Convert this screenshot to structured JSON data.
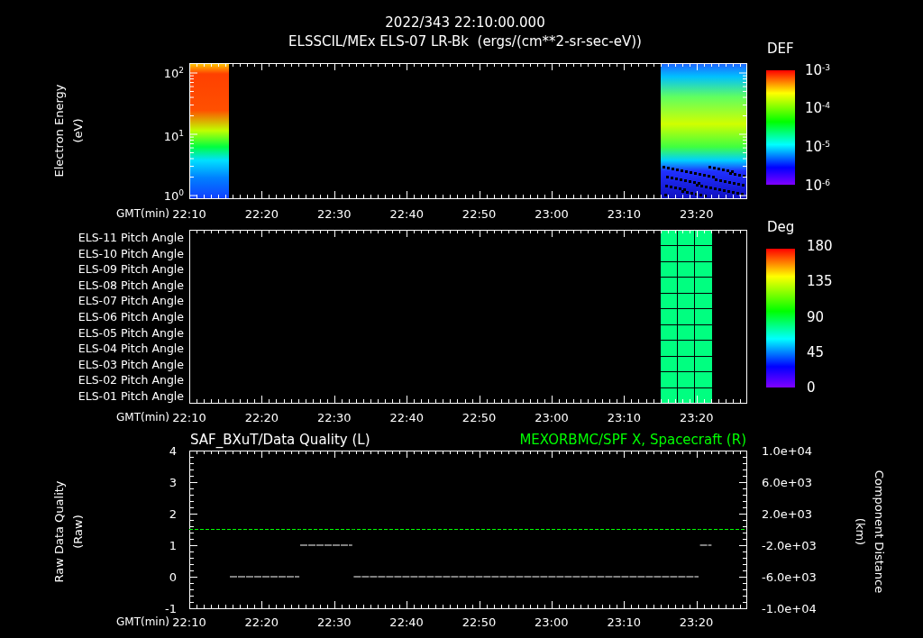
{
  "header": {
    "timestamp": "2022/343 22:10:00.000",
    "dataset": "ELSSCIL/MEx ELS-07 LR-Bk  (ergs/(cm**2-sr-sec-eV))"
  },
  "energy_panel": {
    "ylabel": [
      "Electron Energy",
      "(eV)"
    ],
    "yticks": [
      "10$^{2}$",
      "10$^{1}$",
      "10$^{0}$"
    ],
    "xaxis_label": "GMT(min)",
    "xticks": [
      "22:10",
      "22:20",
      "22:30",
      "22:40",
      "22:50",
      "23:00",
      "23:10",
      "23:20"
    ],
    "colorbar": {
      "title": "DEF",
      "ticks": [
        "10$^{-3}$",
        "10$^{-4}$",
        "10$^{-5}$",
        "10$^{-6}$"
      ]
    }
  },
  "pitch_panel": {
    "rows": [
      "ELS-11 Pitch Angle",
      "ELS-10 Pitch Angle",
      "ELS-09 Pitch Angle",
      "ELS-08 Pitch Angle",
      "ELS-07 Pitch Angle",
      "ELS-06 Pitch Angle",
      "ELS-05 Pitch Angle",
      "ELS-04 Pitch Angle",
      "ELS-03 Pitch Angle",
      "ELS-02 Pitch Angle",
      "ELS-01 Pitch Angle"
    ],
    "xaxis_label": "GMT(min)",
    "xticks": [
      "22:10",
      "22:20",
      "22:30",
      "22:40",
      "22:50",
      "23:00",
      "23:10",
      "23:20"
    ],
    "colorbar": {
      "title": "Deg",
      "ticks": [
        "180",
        "135",
        "90",
        "45",
        "0"
      ]
    }
  },
  "quality_panel": {
    "ylabel": [
      "Raw Data Quality",
      "(Raw)"
    ],
    "y2label": [
      "Component Distance",
      "(km)"
    ],
    "xaxis_label": "GMT(min)",
    "chart_data": {
      "type": "line",
      "x": [
        22.1667,
        22.26,
        22.42,
        22.4208,
        22.4217,
        22.5417,
        22.5433,
        22.545,
        23.3383,
        23.34,
        23.3417,
        23.3683,
        23.4483
      ],
      "xlim": [
        22.1667,
        23.4483
      ],
      "xticks": [
        {
          "value": 22.1667,
          "label": "22:10"
        },
        {
          "value": 22.3333,
          "label": "22:20"
        },
        {
          "value": 22.5,
          "label": "22:30"
        },
        {
          "value": 22.6667,
          "label": "22:40"
        },
        {
          "value": 22.8333,
          "label": "22:50"
        },
        {
          "value": 23,
          "label": "23:00"
        },
        {
          "value": 23.1667,
          "label": "23:10"
        },
        {
          "value": 23.3333,
          "label": "23:20"
        }
      ],
      "ylim": [
        -1,
        4
      ],
      "yticks": [
        4,
        3,
        2,
        1,
        0,
        -1
      ],
      "y2lim": [
        -10000,
        10000
      ],
      "y2ticks": [
        {
          "value": 10000,
          "label": "1.0e+04"
        },
        {
          "value": 6000,
          "label": "6.0e+03"
        },
        {
          "value": 2000,
          "label": "2.0e+03"
        },
        {
          "value": -2000,
          "label": "-2.0e+03"
        },
        {
          "value": -6000,
          "label": "-6.0e+03"
        },
        {
          "value": -10000,
          "label": "-1.0e+04"
        }
      ],
      "series": [
        {
          "name": "SAF_BXuT/Data Quality (L)",
          "color": "#ffffff",
          "line_style": "dashed",
          "values": [
            null,
            0,
            0,
            null,
            1,
            1,
            null,
            0,
            0,
            null,
            1,
            1,
            null
          ]
        },
        {
          "name": "MEXORBMC/SPF X, Spacecraft (R)",
          "color": "#00ff00",
          "axis": "y2",
          "line_style": "dashed",
          "values": [
            0,
            0,
            0,
            0,
            0,
            0,
            0,
            0,
            0,
            0,
            0,
            0,
            0
          ]
        }
      ]
    }
  }
}
